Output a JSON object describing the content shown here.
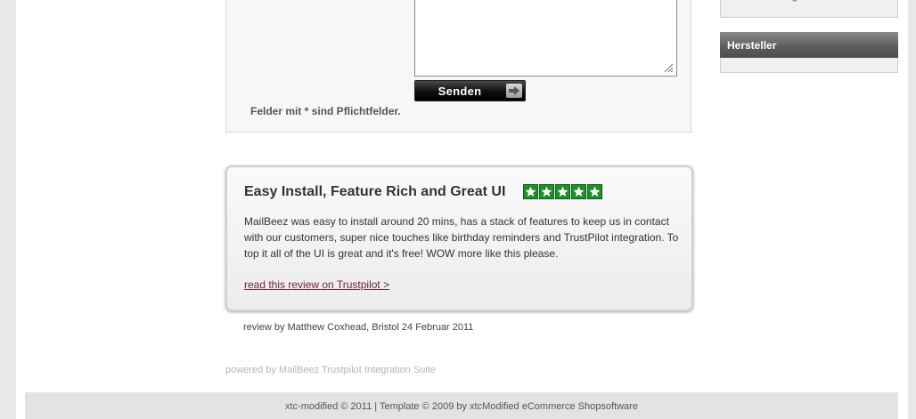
{
  "form": {
    "send_label": "Senden",
    "required_note": "Felder mit * sind Pflichtfelder."
  },
  "sidebar": {
    "top_partial": "g",
    "manufacturer_title": "Hersteller"
  },
  "review": {
    "title": "Easy Install, Feature Rich and Great UI",
    "stars": 5,
    "star_color": "#1e8f2b",
    "text": "MailBeez was easy to install around 20 mins, has a stack of features to keep us in contact with our customers, super nice touches like birthday reminders and TrustPilot integration. To top it all of the UI is great and it's free! WOW more like this please.",
    "link_label": "read this review on Trustpilot >",
    "byline": "review by Matthew Coxhead, Bristol 24 Februar 2011",
    "powered_by": "powered by MailBeez Trustpilot Integration Suite"
  },
  "footer": {
    "text": "xtc-modified © 2011 | Template © 2009 by xtcModified eCommerce Shopsoftware"
  }
}
